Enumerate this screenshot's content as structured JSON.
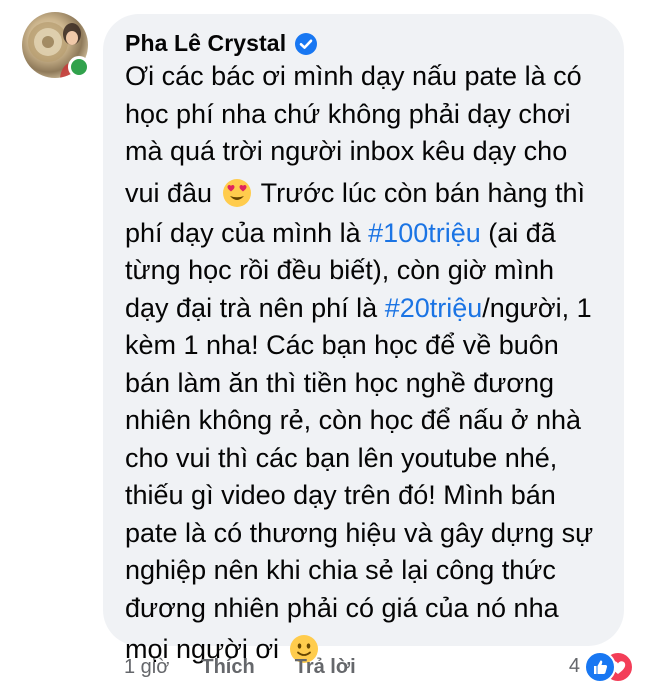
{
  "comment": {
    "author": "Pha Lê Crystal",
    "verified": true,
    "online": true,
    "lines": [
      {
        "parts": [
          {
            "t": "Ơi các bác ơi mình dạy nấu pate là có"
          }
        ]
      },
      {
        "parts": [
          {
            "t": "học phí nha chứ không phải dạy chơi"
          }
        ]
      },
      {
        "parts": [
          {
            "t": "mà quá trời người inbox kêu dạy cho"
          }
        ]
      },
      {
        "parts": [
          {
            "t": "vui đâu "
          },
          {
            "emoji": "heart-eyes"
          },
          {
            "t": " Trước lúc còn bán hàng thì"
          }
        ]
      },
      {
        "parts": [
          {
            "t": "phí dạy của mình là "
          },
          {
            "tag": "#100triệu"
          },
          {
            "t": " (ai đã"
          }
        ]
      },
      {
        "parts": [
          {
            "t": "từng học rồi đều biết), còn giờ mình"
          }
        ]
      },
      {
        "parts": [
          {
            "t": "dạy đại trà nên phí là "
          },
          {
            "tag": "#20triệu"
          },
          {
            "t": "/người, 1"
          }
        ]
      },
      {
        "parts": [
          {
            "t": "kèm 1 nha! Các bạn học để về buôn"
          }
        ]
      },
      {
        "parts": [
          {
            "t": "bán làm ăn thì tiền học nghề đương"
          }
        ]
      },
      {
        "parts": [
          {
            "t": "nhiên không rẻ, còn học để nấu ở nhà"
          }
        ]
      },
      {
        "parts": [
          {
            "t": "cho vui thì các bạn lên youtube nhé,"
          }
        ]
      },
      {
        "parts": [
          {
            "t": "thiếu gì video dạy trên đó! Mình bán"
          }
        ]
      },
      {
        "parts": [
          {
            "t": "pate là có thương hiệu và gây dựng sự"
          }
        ]
      },
      {
        "parts": [
          {
            "t": "nghiệp nên khi chia sẻ lại công thức"
          }
        ]
      },
      {
        "parts": [
          {
            "t": "đương nhiên phải có giá của nó nha"
          }
        ]
      },
      {
        "parts": [
          {
            "t": "mọi người ơi "
          },
          {
            "emoji": "slight-smile"
          }
        ]
      }
    ]
  },
  "actions": {
    "time": "1 giờ",
    "like_label": "Thích",
    "reply_label": "Trả lời"
  },
  "reactions": {
    "count": "4",
    "types": [
      "like",
      "love"
    ]
  },
  "colors": {
    "bubble": "#f0f2f5",
    "hashtag": "#1b74e4",
    "online": "#31a24c",
    "like": "#1877f2",
    "love": "#f33e58"
  }
}
